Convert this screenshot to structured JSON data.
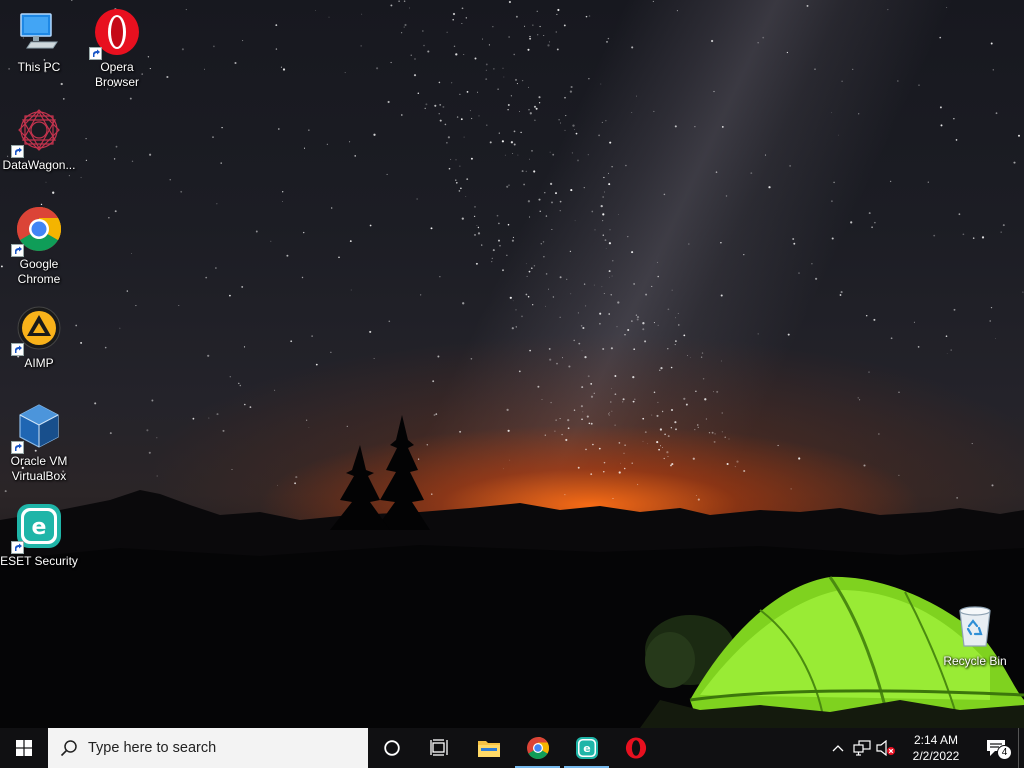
{
  "desktop": {
    "icons": [
      {
        "name": "This PC",
        "label": "This PC",
        "shortcut": false
      },
      {
        "name": "Opera Browser",
        "label": "Opera Browser",
        "shortcut": true
      },
      {
        "name": "DataWagon",
        "label": "DataWagon...",
        "shortcut": true
      },
      {
        "name": "Google Chrome",
        "label": "Google Chrome",
        "shortcut": true
      },
      {
        "name": "AIMP",
        "label": "AIMP",
        "shortcut": true
      },
      {
        "name": "Oracle VM VirtualBox",
        "label": "Oracle VM VirtualBox",
        "shortcut": true
      },
      {
        "name": "ESET Security",
        "label": "ESET Security",
        "shortcut": true
      },
      {
        "name": "Recycle Bin",
        "label": "Recycle Bin",
        "shortcut": false
      }
    ]
  },
  "taskbar": {
    "start_icon": "windows-logo-icon",
    "search": {
      "placeholder": "Type here to search",
      "icon": "search-icon"
    },
    "cortana_icon": "cortana-circle-icon",
    "task_view_icon": "task-view-icon",
    "pinned": [
      {
        "name": "File Explorer",
        "icon": "folder-icon",
        "active": false
      },
      {
        "name": "Google Chrome",
        "icon": "chrome-icon",
        "active": true
      },
      {
        "name": "ESET Security",
        "icon": "eset-icon",
        "active": true
      },
      {
        "name": "Opera",
        "icon": "opera-icon",
        "active": false
      }
    ],
    "tray": {
      "icons": [
        "chevron-up-icon",
        "network-icon",
        "volume-muted-icon"
      ],
      "time": "2:14 AM",
      "date": "2/2/2022",
      "notification_count": "4"
    }
  },
  "colors": {
    "taskbar_bg": "#101012",
    "search_bg": "#f3f3f3",
    "active_indicator": "#76b9ed",
    "tent_green": "#8fe22b"
  }
}
